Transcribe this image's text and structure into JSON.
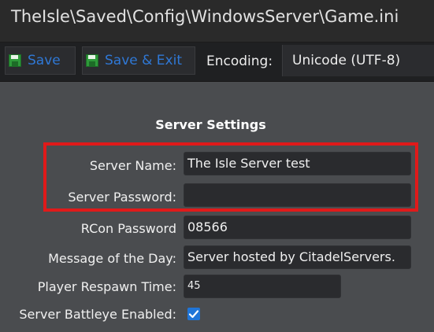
{
  "window": {
    "title": "TheIsle\\Saved\\Config\\WindowsServer\\Game.ini"
  },
  "toolbar": {
    "save_label": "Save",
    "save_exit_label": "Save & Exit",
    "encoding_label": "Encoding:",
    "encoding_value": "Unicode (UTF-8)",
    "icon": "floppy-disk-icon",
    "accent_color": "#2f78d6"
  },
  "section": {
    "title": "Server Settings"
  },
  "fields": {
    "server_name": {
      "label": "Server Name:",
      "value": "The Isle Server test"
    },
    "server_password": {
      "label": "Server Password:",
      "value": ""
    },
    "rcon_password": {
      "label": "RCon Password",
      "value": "08566"
    },
    "motd": {
      "label": "Message of the Day:",
      "value": "Server hosted by CitadelServers."
    },
    "respawn_time": {
      "label": "Player Respawn Time:",
      "value": "45"
    },
    "battleye": {
      "label": "Server Battleye Enabled:",
      "checked": true
    }
  },
  "annotation": {
    "highlight_color": "#e01a1a"
  }
}
